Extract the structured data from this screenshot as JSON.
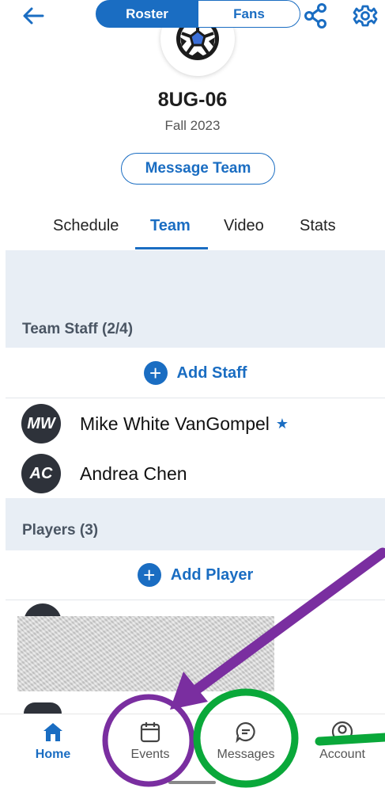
{
  "header": {
    "back_icon": "arrow-left-icon",
    "share_icon": "share-icon",
    "settings_icon": "gear-icon",
    "team_logo_icon": "soccer-ball-icon"
  },
  "team": {
    "name": "8UG-06",
    "season": "Fall 2023",
    "message_button": "Message Team"
  },
  "tabs": [
    "Schedule",
    "Team",
    "Video",
    "Stats"
  ],
  "active_tab": "Team",
  "segments": {
    "roster": "Roster",
    "fans": "Fans",
    "selected": "Roster"
  },
  "staff": {
    "label": "Team Staff (2/4)",
    "add_label": "Add Staff",
    "members": [
      {
        "initials": "MW",
        "name": "Mike White VanGompel",
        "starred": true
      },
      {
        "initials": "AC",
        "name": "Andrea Chen",
        "starred": false
      }
    ]
  },
  "players": {
    "label": "Players (3)",
    "add_label": "Add Player"
  },
  "bottom_nav": {
    "items": [
      {
        "label": "Home",
        "icon": "home-icon",
        "active": true
      },
      {
        "label": "Events",
        "icon": "calendar-icon",
        "active": false
      },
      {
        "label": "Messages",
        "icon": "chat-bubble-icon",
        "active": false
      },
      {
        "label": "Account",
        "icon": "account-icon",
        "active": false
      }
    ]
  },
  "colors": {
    "accent": "#1a6dc2",
    "panel": "#e8eef5",
    "annotation_purple": "#7a2ea0",
    "annotation_green": "#0aa83a"
  }
}
